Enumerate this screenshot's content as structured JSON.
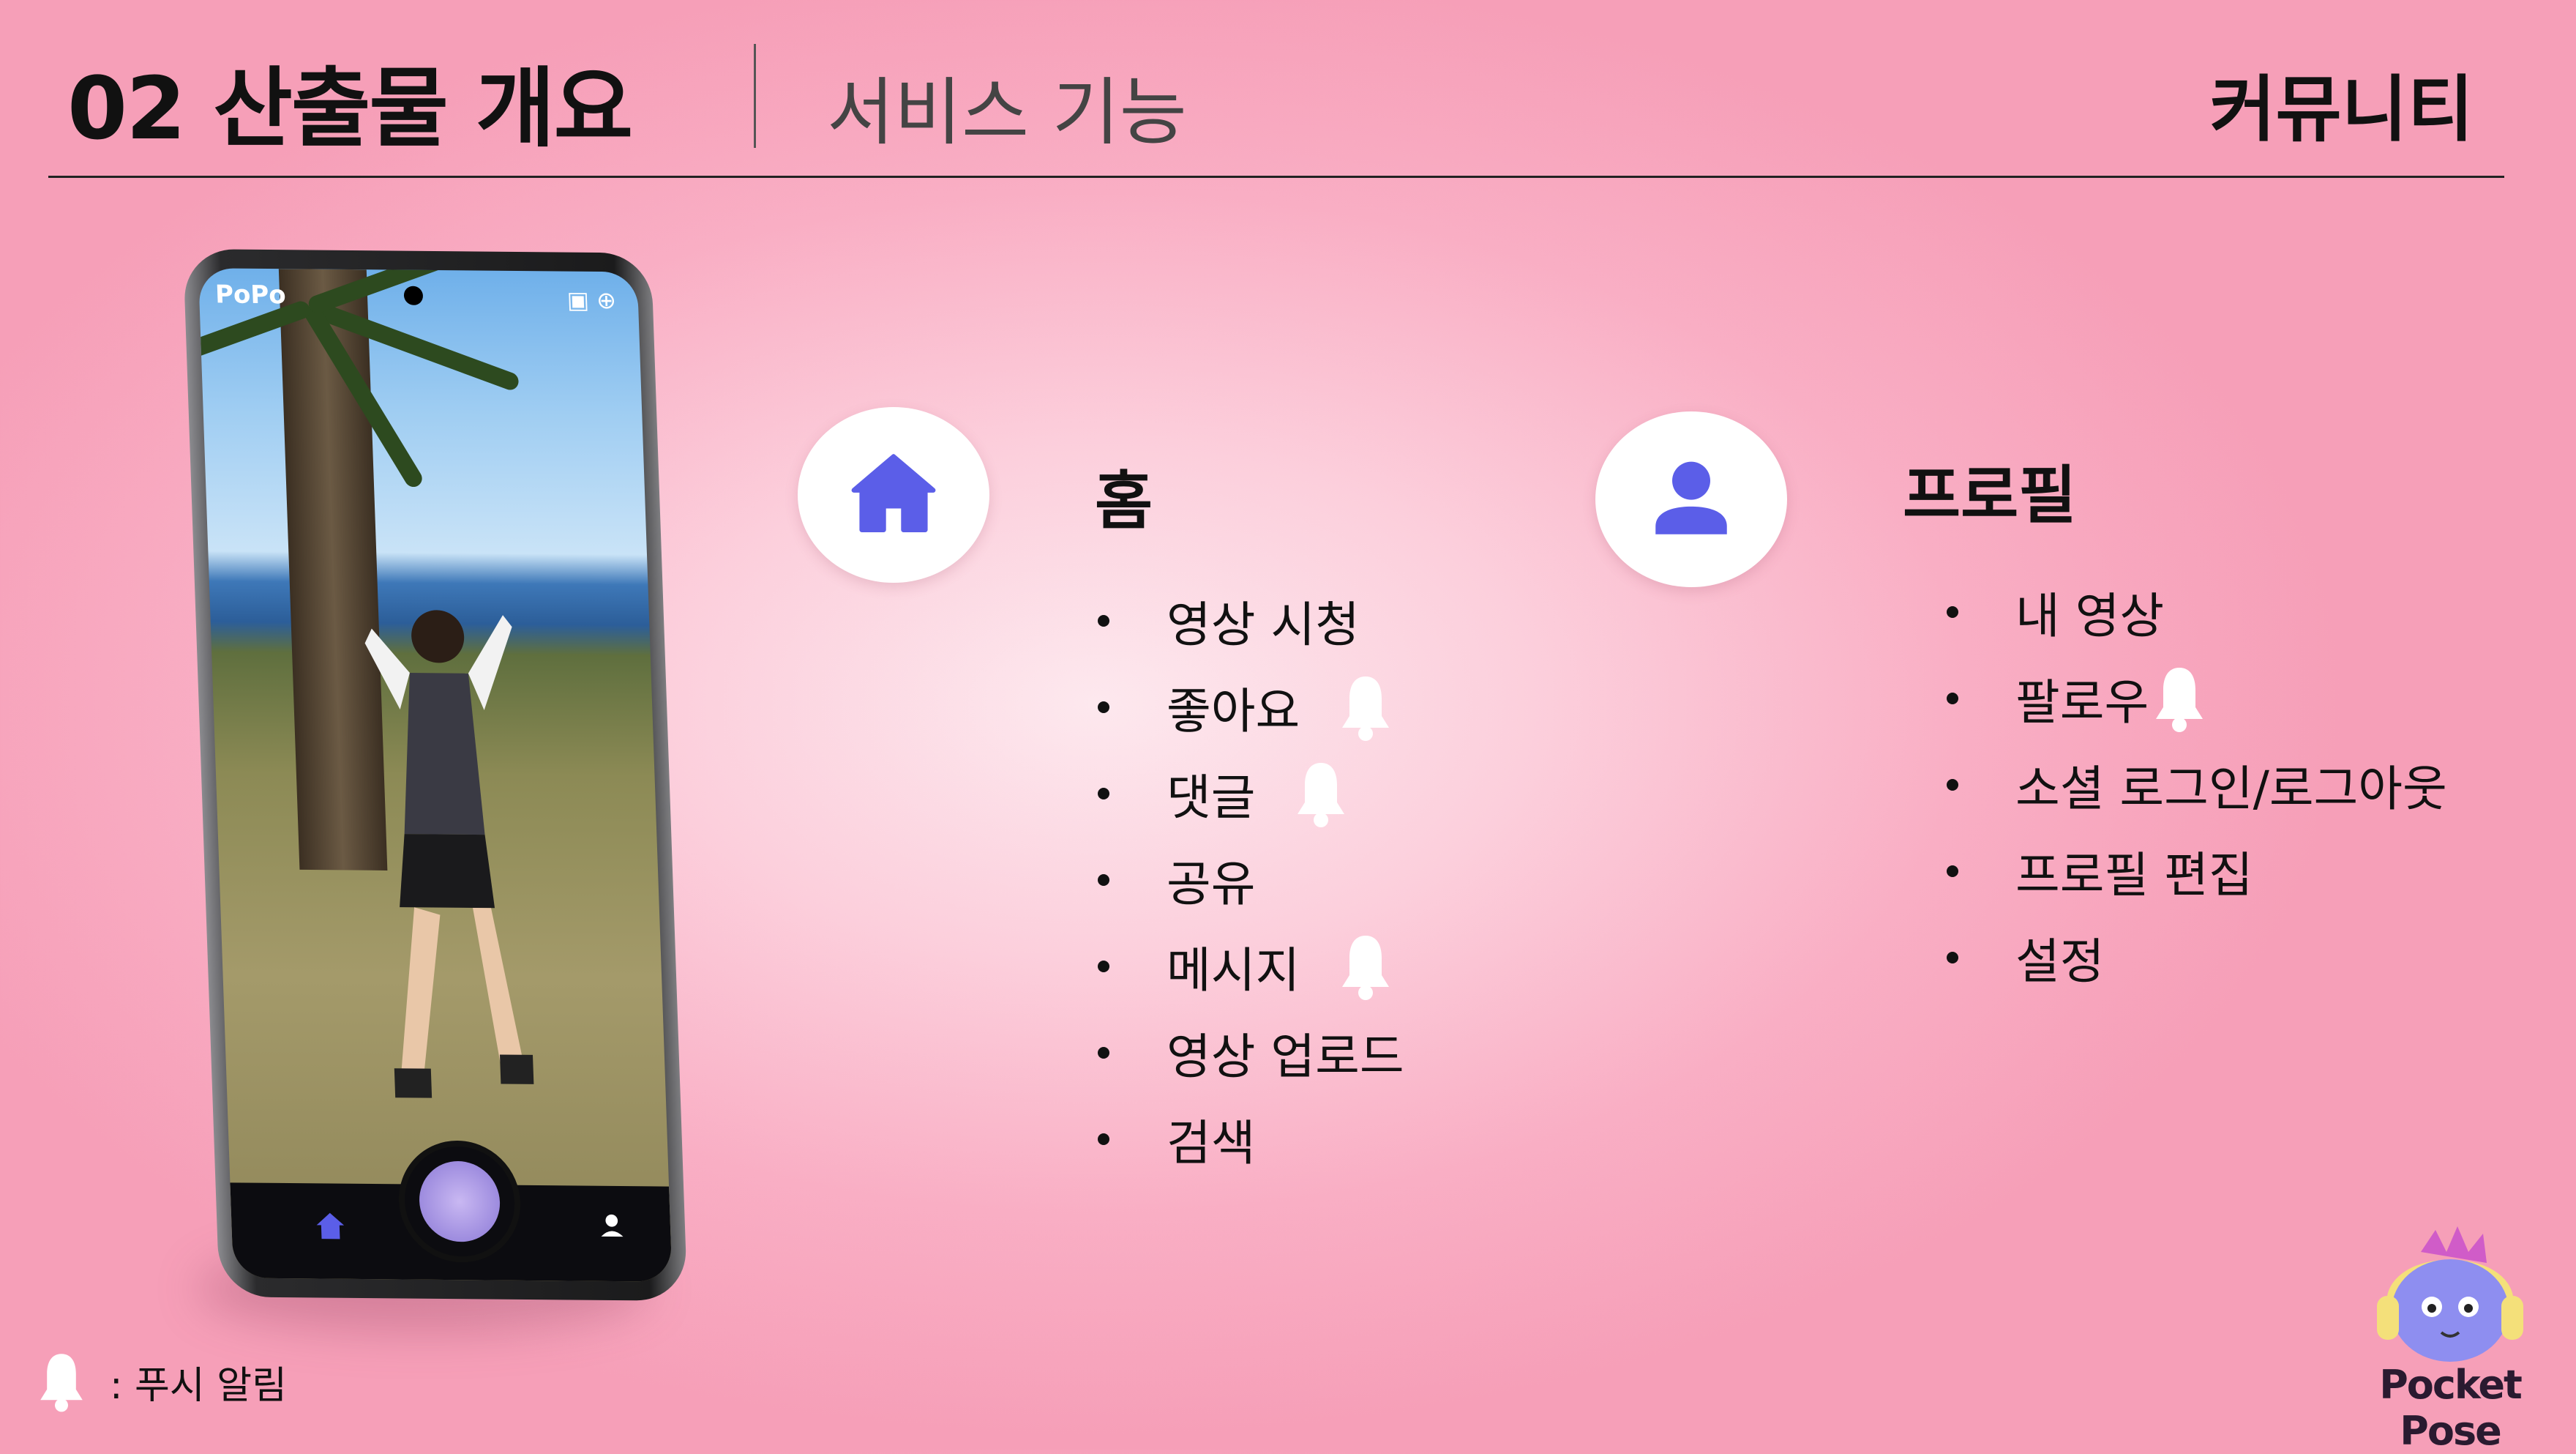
{
  "header": {
    "title": "02 산출물 개요",
    "subtitle": "서비스 기능",
    "section": "커뮤니티"
  },
  "phone": {
    "app_logo": "PoPo",
    "icons": [
      "home-icon",
      "user-icon",
      "mascot-button"
    ]
  },
  "home": {
    "title": "홈",
    "icon": "home-icon",
    "items": [
      {
        "label": "영상 시청",
        "push": false
      },
      {
        "label": "좋아요",
        "push": true
      },
      {
        "label": "댓글",
        "push": true
      },
      {
        "label": "공유",
        "push": false
      },
      {
        "label": "메시지",
        "push": true
      },
      {
        "label": "영상 업로드",
        "push": false
      },
      {
        "label": "검색",
        "push": false
      }
    ]
  },
  "profile": {
    "title": "프로필",
    "icon": "user-icon",
    "items": [
      {
        "label": "내 영상",
        "push": false
      },
      {
        "label": "팔로우",
        "push": true
      },
      {
        "label": "소셜 로그인/로그아웃",
        "push": false
      },
      {
        "label": "프로필 편집",
        "push": false
      },
      {
        "label": "설정",
        "push": false
      }
    ]
  },
  "legend": {
    "icon": "bell-icon",
    "text": ":  푸시 알림"
  },
  "brand": {
    "name": "Pocket Pose"
  },
  "colors": {
    "accent": "#5b5ee8",
    "bell": "#ffffff"
  }
}
